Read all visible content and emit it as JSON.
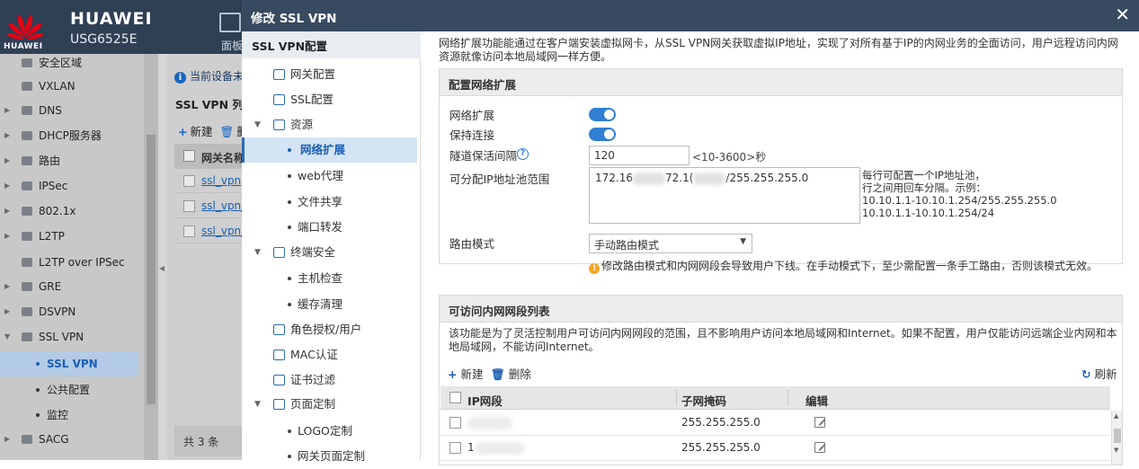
{
  "header": {
    "brand": "HUAWEI",
    "model": "USG6525E",
    "logo_text": "HUAWEI",
    "tab_label": "面板"
  },
  "sidebar": {
    "items": [
      {
        "label": "安全区域",
        "icon": "zone-icon"
      },
      {
        "label": "VXLAN",
        "icon": "vxlan-icon"
      },
      {
        "label": "DNS",
        "icon": "dns-icon"
      },
      {
        "label": "DHCP服务器",
        "icon": "dhcp-icon"
      },
      {
        "label": "路由",
        "icon": "route-icon"
      },
      {
        "label": "IPSec",
        "icon": "ipsec-icon"
      },
      {
        "label": "802.1x",
        "icon": "8021x-icon"
      },
      {
        "label": "L2TP",
        "icon": "l2tp-icon"
      },
      {
        "label": "L2TP over IPSec",
        "icon": "l2tp-ipsec-icon"
      },
      {
        "label": "GRE",
        "icon": "gre-icon"
      },
      {
        "label": "DSVPN",
        "icon": "dsvpn-icon"
      },
      {
        "label": "SSL VPN",
        "icon": "sslvpn-icon"
      },
      {
        "label": "SSL VPN",
        "active": true
      },
      {
        "label": "公共配置"
      },
      {
        "label": "监控"
      },
      {
        "label": "SACG",
        "icon": "sacg-icon"
      }
    ]
  },
  "main_bg": {
    "notice": "当前设备未",
    "list_title": "SSL VPN 列表",
    "new_label": "新建",
    "delete_label": "删除",
    "col_gateway": "网关名称",
    "rows": [
      "ssl_vpn",
      "ssl_vpn_",
      "ssl_vpn_"
    ],
    "footer": "共 3 条"
  },
  "modal": {
    "title": "修改 SSL VPN",
    "nav_title": "SSL VPN配置",
    "nav": [
      {
        "label": "网关配置",
        "level": 1
      },
      {
        "label": "SSL配置",
        "level": 1
      },
      {
        "label": "资源",
        "level": 1,
        "expanded": true
      },
      {
        "label": "网络扩展",
        "level": 2,
        "active": true
      },
      {
        "label": "web代理",
        "level": 2
      },
      {
        "label": "文件共享",
        "level": 2
      },
      {
        "label": "端口转发",
        "level": 2
      },
      {
        "label": "终端安全",
        "level": 1,
        "expanded": true
      },
      {
        "label": "主机检查",
        "level": 2
      },
      {
        "label": "缓存清理",
        "level": 2
      },
      {
        "label": "角色授权/用户",
        "level": 1
      },
      {
        "label": "MAC认证",
        "level": 1
      },
      {
        "label": "证书过滤",
        "level": 1
      },
      {
        "label": "页面定制",
        "level": 1,
        "expanded": true
      },
      {
        "label": "LOGO定制",
        "level": 2
      },
      {
        "label": "网关页面定制",
        "level": 2
      }
    ],
    "description": "网络扩展功能能通过在客户端安装虚拟网卡，从SSL VPN网关获取虚拟IP地址，实现了对所有基于IP的内网业务的全面访问，用户远程访问内网资源就像访问本地局域网一样方便。",
    "config": {
      "section_title": "配置网络扩展",
      "network_extension_label": "网络扩展",
      "network_extension_on": true,
      "keepalive_label": "保持连接",
      "keepalive_on": true,
      "tunnel_interval_label": "隧道保活间隔",
      "tunnel_interval_value": "120",
      "tunnel_interval_range": "<10-3600>秒",
      "pool_label": "可分配IP地址池范围",
      "pool_part1": "172.16",
      "pool_part2": "72.1(",
      "pool_part3": "/255.255.255.0",
      "pool_hint": "每行可配置一个IP地址池，\n行之间用回车分隔。示例：\n10.10.1.1-10.10.1.254/255.255.255.0\n10.10.1.1-10.10.1.254/24",
      "route_mode_label": "路由模式",
      "route_mode_value": "手动路由模式",
      "route_mode_warning": "修改路由模式和内网网段会导致用户下线。在手动模式下，至少需配置一条手工路由，否则该模式无效。"
    },
    "intranet": {
      "section_title": "可访问内网网段列表",
      "description": "该功能是为了灵活控制用户可访问内网网段的范围，且不影响用户访问本地局域网和Internet。如果不配置，用户仅能访问远端企业内网和本地局域网，不能访问Internet。",
      "new_label": "新建",
      "delete_label": "删除",
      "refresh_label": "刷新",
      "columns": [
        "IP网段",
        "子网掩码",
        "编辑"
      ],
      "rows": [
        {
          "ip": "",
          "mask": "255.255.255.0"
        },
        {
          "ip": "1",
          "mask": "255.255.255.0"
        }
      ]
    }
  }
}
